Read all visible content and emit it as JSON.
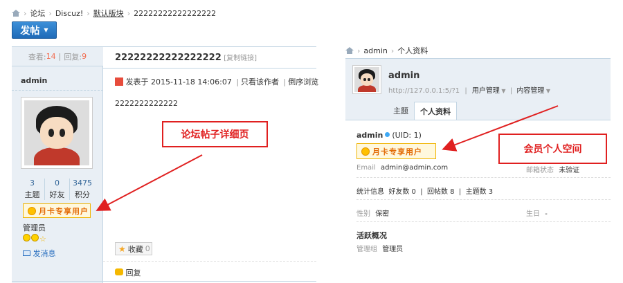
{
  "forum": {
    "breadcrumb": {
      "items": [
        "论坛",
        "Discuz!",
        "默认版块",
        "22222222222222222"
      ]
    },
    "post_button": "发帖",
    "stats": {
      "views_label": "查看:",
      "views": "14",
      "replies_label": "回复:",
      "replies": "9"
    },
    "thread": {
      "title": "22222222222222222",
      "copy_link": "[复制链接]",
      "posted_at": "发表于 2015-11-18 14:06:07",
      "only_author": "只看该作者",
      "reverse": "倒序浏览",
      "content": "2222222222222",
      "favorite": "收藏",
      "favorite_count": "0",
      "reply": "回复"
    },
    "author": {
      "name": "admin",
      "stats": [
        {
          "value": "3",
          "label": "主题"
        },
        {
          "value": "0",
          "label": "好友"
        },
        {
          "value": "3475",
          "label": "积分"
        }
      ],
      "badge": "月卡专享用户",
      "group": "管理员",
      "send_message": "发消息"
    },
    "callout": "论坛帖子详细页"
  },
  "profile": {
    "breadcrumb": {
      "items": [
        "admin",
        "个人资料"
      ]
    },
    "username": "admin",
    "url": "http://127.0.0.1:5/?1",
    "menu": {
      "user_mgmt": "用户管理",
      "content_mgmt": "内容管理"
    },
    "tabs": [
      "主题",
      "个人资料"
    ],
    "uid": "(UID: 1)",
    "badge": "月卡专享用户",
    "email_label": "Email",
    "email": "admin@admin.com",
    "email_status_label": "邮箱状态",
    "email_status": "未验证",
    "stats_line": "统计信息  好友数 0  |  回帖数 8  |  主题数 3",
    "gender_label": "性别",
    "gender": "保密",
    "birthday_label": "生日",
    "birthday": "-",
    "activity_title": "活跃概况",
    "group_label": "管理组",
    "group": "管理员",
    "callout": "会员个人空间"
  },
  "colors": {
    "accent": "#1f6bb8",
    "callout": "#e02020",
    "sidebar": "#e9eff5"
  }
}
